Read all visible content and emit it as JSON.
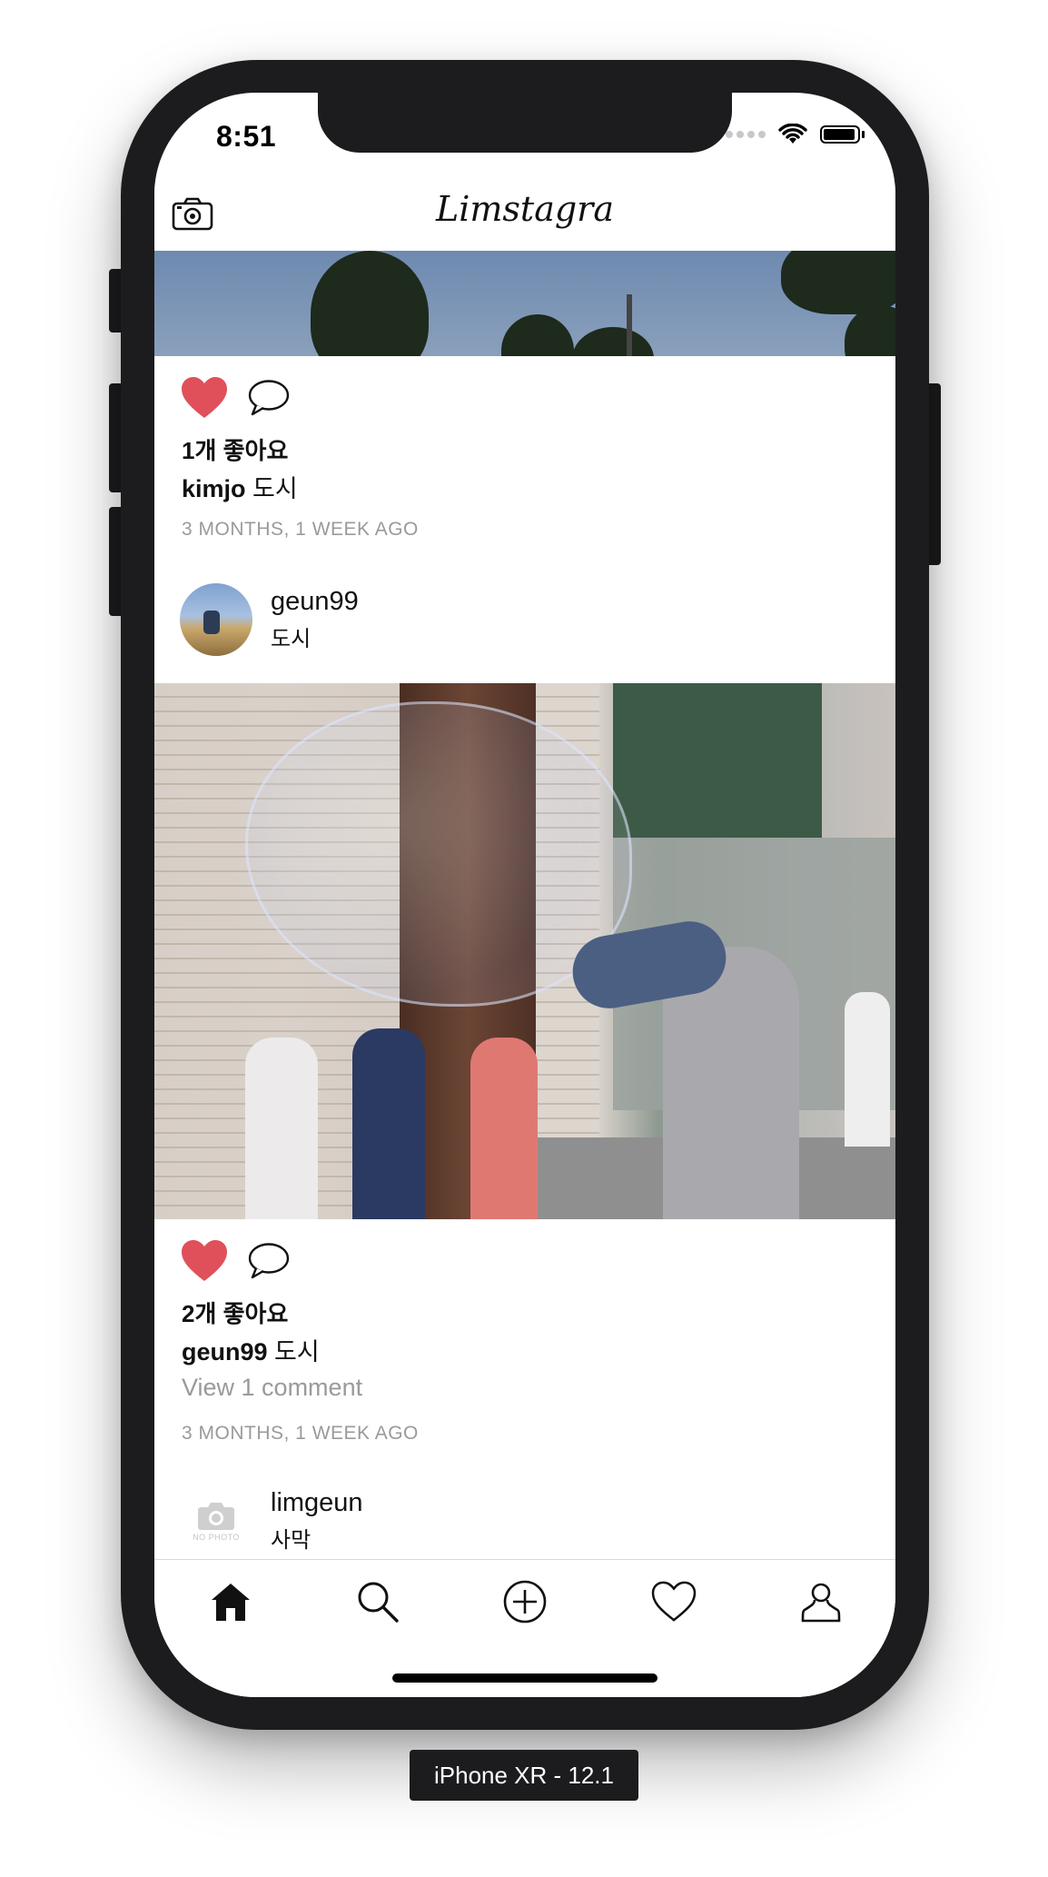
{
  "status_bar": {
    "time": "8:51"
  },
  "nav": {
    "title": "Limstagra"
  },
  "posts": [
    {
      "likes": "1개 좋아요",
      "caption_user": "kimjo",
      "caption_text": "도시",
      "timestamp": "3 MONTHS, 1 WEEK AGO"
    },
    {
      "username": "geun99",
      "location": "도시",
      "likes": "2개 좋아요",
      "caption_user": "geun99",
      "caption_text": "도시",
      "comments_link": "View 1 comment",
      "timestamp": "3 MONTHS, 1 WEEK AGO"
    },
    {
      "username": "limgeun",
      "location": "사막",
      "avatar_placeholder": "NO PHOTO"
    }
  ],
  "tabbar": {
    "tabs": [
      "home-icon",
      "search-icon",
      "add-post-icon",
      "activity-heart-icon",
      "profile-icon"
    ]
  },
  "device_label": "iPhone XR - 12.1",
  "colors": {
    "like_red": "#e0505a",
    "secondary_gray": "#9a9a9a"
  }
}
